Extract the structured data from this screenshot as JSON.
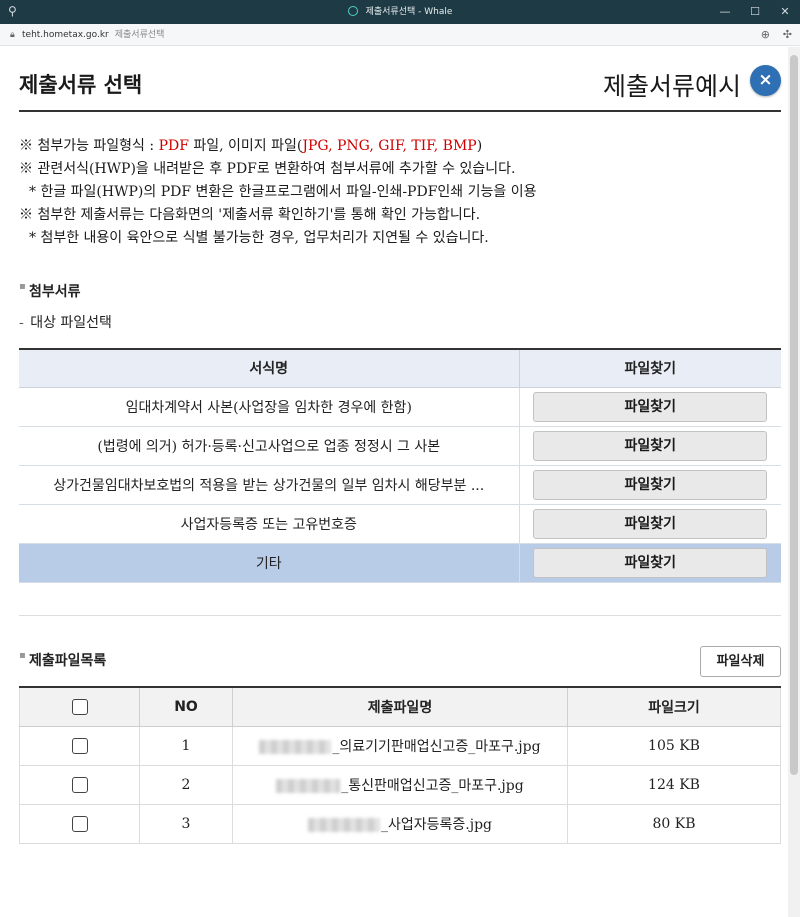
{
  "window": {
    "title": "제출서류선택 - Whale",
    "minimize": "—",
    "maximize": "☐",
    "close": "✕"
  },
  "address": {
    "url": "teht.hometax.go.kr",
    "page_title": "제출서류선택"
  },
  "header": {
    "title": "제출서류 선택",
    "example_link": "제출서류예시",
    "close": "×"
  },
  "notes": {
    "line1_prefix": "※ 첨부가능 파일형식 : ",
    "line1_pdf": "PDF",
    "line1_mid": " 파일, 이미지 파일(",
    "line1_formats": "JPG, PNG, GIF, TIF, BMP",
    "line1_suffix": ")",
    "line2": "※ 관련서식(HWP)을 내려받은 후 PDF로 변환하여 첨부서류에 추가할 수 있습니다.",
    "line3": "* 한글 파일(HWP)의 PDF 변환은 한글프로그램에서 파일-인쇄-PDF인쇄 기능을 이용",
    "line4": "※ 첨부한 제출서류는 다음화면의 '제출서류 확인하기'를 통해 확인 가능합니다.",
    "line5": "* 첨부한 내용이 육안으로 식별 불가능한 경우, 업무처리가 지연될 수 있습니다."
  },
  "attach": {
    "section_title": "첨부서류",
    "sub_label": "대상 파일선택",
    "col_name": "서식명",
    "col_find": "파일찾기",
    "rows": [
      {
        "name": "임대차계약서 사본(사업장을 임차한 경우에 한함)",
        "button": "파일찾기"
      },
      {
        "name": "(법령에 의거) 허가·등록·신고사업으로 업종 정정시 그 사본",
        "button": "파일찾기"
      },
      {
        "name": "상가건물임대차보호법의 적용을 받는 상가건물의 일부 임차시 해당부분 ...",
        "button": "파일찾기"
      },
      {
        "name": "사업자등록증 또는 고유번호증",
        "button": "파일찾기"
      },
      {
        "name": "기타",
        "button": "파일찾기"
      }
    ]
  },
  "files": {
    "section_title": "제출파일목록",
    "delete_button": "파일삭제",
    "col_no": "NO",
    "col_name": "제출파일명",
    "col_size": "파일크기",
    "rows": [
      {
        "no": "1",
        "name": "_의료기기판매업신고증_마포구.jpg",
        "size": "105 KB"
      },
      {
        "no": "2",
        "name": "_통신판매업신고증_마포구.jpg",
        "size": "124 KB"
      },
      {
        "no": "3",
        "name": "_사업자등록증.jpg",
        "size": "80 KB"
      }
    ]
  },
  "colors": {
    "accent_blue": "#2f6fb3",
    "highlight_row": "#b8cce8",
    "red_text": "#d00000"
  }
}
